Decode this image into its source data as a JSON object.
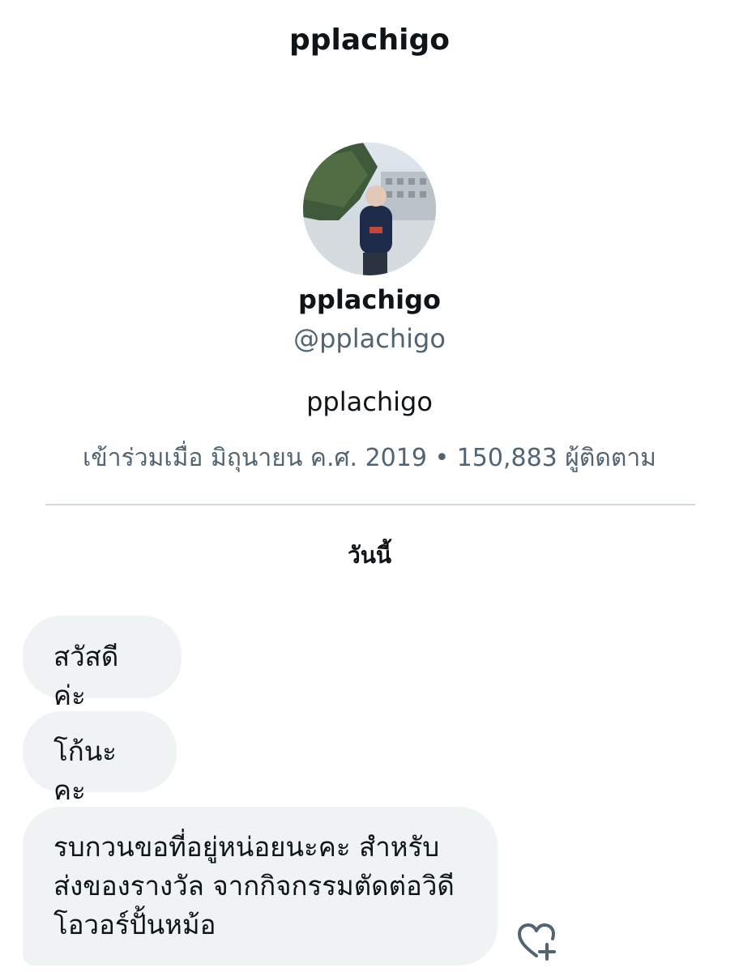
{
  "header": {
    "title": "pplachigo"
  },
  "profile": {
    "avatar_alt": "profile photo",
    "display_name": "pplachigo",
    "handle": "@pplachigo",
    "bio": "pplachigo",
    "meta": "เข้าร่วมเมื่อ มิถุนายน ค.ศ. 2019 • 150,883 ผู้ติดตาม"
  },
  "conversation": {
    "date_label": "วันนี้",
    "messages": [
      {
        "text": "สวัสดีค่ะ"
      },
      {
        "text": "โก้นะคะ"
      },
      {
        "text": "รบกวนขอที่อยู่หน่อยนะคะ สำหรับส่งของรางวัล จากกิจกรรมตัดต่อวิดีโอวอร์ปั้นหม้อ"
      }
    ],
    "react_icon": "heart-plus-icon"
  },
  "colors": {
    "text_primary": "#0f1419",
    "text_secondary": "#536471",
    "bubble_bg": "#eff3f4",
    "divider": "#cfd9de"
  }
}
